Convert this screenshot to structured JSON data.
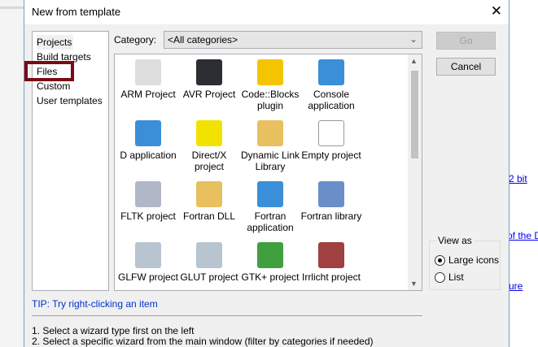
{
  "dialog": {
    "title": "New from template"
  },
  "categories": [
    "Projects",
    "Build targets",
    "Files",
    "Custom",
    "User templates"
  ],
  "highlighted": "Files",
  "category": {
    "label": "Category:",
    "value": "<All categories>"
  },
  "templates": [
    {
      "label": "ARM Project",
      "icon": "gnu-icon",
      "color": "#dddddd"
    },
    {
      "label": "AVR Project",
      "icon": "avr-chip-icon",
      "color": "#2b2f33"
    },
    {
      "label": "Code::Blocks plugin",
      "icon": "puzzle-icon",
      "color": "#f5c400"
    },
    {
      "label": "Console application",
      "icon": "console-icon",
      "color": "#3a8fd8"
    },
    {
      "label": "D application",
      "icon": "d-app-icon",
      "color": "#3a8fd8"
    },
    {
      "label": "Direct/X project",
      "icon": "directx-icon",
      "color": "#f2e200"
    },
    {
      "label": "Dynamic Link Library",
      "icon": "dll-icon",
      "color": "#e8c060"
    },
    {
      "label": "Empty project",
      "icon": "blank-file-icon",
      "color": "#ffffff"
    },
    {
      "label": "FLTK project",
      "icon": "fltk-icon",
      "color": "#b0b8c8"
    },
    {
      "label": "Fortran DLL",
      "icon": "dll-icon",
      "color": "#e8c060"
    },
    {
      "label": "Fortran application",
      "icon": "fortran-app-icon",
      "color": "#3a8fd8"
    },
    {
      "label": "Fortran library",
      "icon": "lib-icon",
      "color": "#6a8fc8"
    },
    {
      "label": "GLFW project",
      "icon": "glfw-icon",
      "color": "#b8c4d0"
    },
    {
      "label": "GLUT project",
      "icon": "glut-icon",
      "color": "#b8c4d0"
    },
    {
      "label": "GTK+ project",
      "icon": "gtk-icon",
      "color": "#40a040"
    },
    {
      "label": "Irrlicht project",
      "icon": "irrlicht-icon",
      "color": "#a04040"
    }
  ],
  "buttons": {
    "go": "Go",
    "cancel": "Cancel"
  },
  "view_as": {
    "label": "View as",
    "options": [
      "Large icons",
      "List"
    ],
    "selected": "Large icons"
  },
  "tip": "TIP: Try right-clicking an item",
  "instructions": [
    "1. Select a wizard type first on the left",
    "2. Select a specific wizard from the main window (filter by categories if needed)"
  ],
  "background_links": [
    "2 bit",
    "of the D",
    "ure"
  ]
}
